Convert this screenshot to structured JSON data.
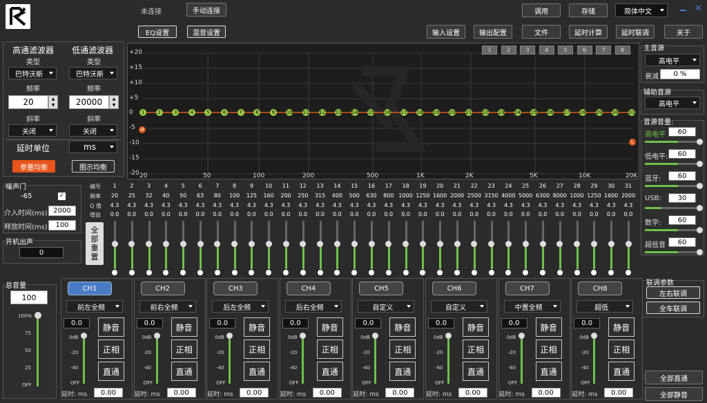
{
  "header": {
    "status": "未连接",
    "connect": "手动连接",
    "tab_eq": "EQ设置",
    "tab_mix": "混音设置",
    "call": "调用",
    "save": "存储",
    "language": "简体中文",
    "nav": [
      "输入设置",
      "输出配置",
      "文件",
      "延时计算",
      "延时联调",
      "关于"
    ]
  },
  "filters": {
    "hp_title": "高通滤波器",
    "lp_title": "低通滤波器",
    "type_label": "类型",
    "hp_type": "巴特沃斯",
    "lp_type": "巴特沃斯",
    "freq_label": "频率",
    "hp_freq": "20",
    "lp_freq": "20000",
    "slope_label": "斜率",
    "hp_slope": "关闭",
    "lp_slope": "关闭",
    "delay_unit_label": "延时单位",
    "delay_unit": "ms",
    "param_eq": "参量均衡",
    "graphic_eq": "图示均衡"
  },
  "noise_gate": {
    "title": "噪声门",
    "value": "-65",
    "attack_label": "介入时间(ms)",
    "attack": "2000",
    "release_label": "释放时间(ms)",
    "release": "100"
  },
  "startup": {
    "title": "开机出声",
    "value": "0"
  },
  "graph": {
    "y_labels": [
      "+20",
      "+15",
      "+10",
      "+5",
      "0",
      "-5",
      "-10",
      "-15",
      "-20"
    ],
    "x_labels": [
      "20",
      "50",
      "100",
      "200",
      "500",
      "1K",
      "2K",
      "5K",
      "10K",
      "20K"
    ],
    "presets": [
      "1",
      "2",
      "3",
      "4",
      "5",
      "6",
      "7",
      "8"
    ],
    "h_marker": "H",
    "l_marker": "L"
  },
  "eq": {
    "row_labels": [
      "编号",
      "频率",
      "Q 值",
      "增益"
    ],
    "freqs": [
      "20",
      "25",
      "32",
      "40",
      "50",
      "63",
      "80",
      "100",
      "125",
      "160",
      "200",
      "250",
      "315",
      "400",
      "500",
      "630",
      "800",
      "1000",
      "1250",
      "1600",
      "2000",
      "2500",
      "3150",
      "4000",
      "5000",
      "6300",
      "8000",
      "1000",
      "1250",
      "1600",
      "2000"
    ],
    "q": "4.3",
    "gain": "0.0",
    "reset": "全部重置"
  },
  "master": {
    "title": "总音量",
    "value": "100",
    "scale": [
      "100%",
      "75",
      "50",
      "25",
      "OFF"
    ]
  },
  "channels": [
    {
      "name": "CH1",
      "pos": "前左全频",
      "val": "0.0",
      "delay": "0.00"
    },
    {
      "name": "CH2",
      "pos": "前右全频",
      "val": "0.0",
      "delay": "0.00"
    },
    {
      "name": "CH3",
      "pos": "后左全频",
      "val": "0.0",
      "delay": "0.00"
    },
    {
      "name": "CH4",
      "pos": "后右全频",
      "val": "0.0",
      "delay": "0.00"
    },
    {
      "name": "CH5",
      "pos": "自定义",
      "val": "0.0",
      "delay": "0.00"
    },
    {
      "name": "CH6",
      "pos": "自定义",
      "val": "0.0",
      "delay": "0.00"
    },
    {
      "name": "CH7",
      "pos": "中置全频",
      "val": "0.0",
      "delay": "0.00"
    },
    {
      "name": "CH8",
      "pos": "超低",
      "val": "0.0",
      "delay": "0.00"
    }
  ],
  "ch_labels": {
    "mute": "静音",
    "phase": "正相",
    "direct": "直通",
    "delay": "延时: ms",
    "scale": [
      "0dB",
      "-20",
      "-40",
      "OFF"
    ]
  },
  "main_source": {
    "title": "主音源",
    "value": "高电平",
    "atten_label": "衰减",
    "atten": "0 %"
  },
  "aux_source": {
    "title": "辅助音源",
    "value": "高电平"
  },
  "source_vol": {
    "title": "音源音量:",
    "items": [
      {
        "label": "高电平",
        "value": "60",
        "level": 0.6
      },
      {
        "label": "低电平:",
        "value": "60",
        "level": 0.6
      },
      {
        "label": "蓝牙:",
        "value": "60",
        "level": 0.6
      },
      {
        "label": "USB:",
        "value": "30",
        "level": 0.3
      },
      {
        "label": "数字:",
        "value": "60",
        "level": 0.6
      },
      {
        "label": "超低音",
        "value": "60",
        "level": 0.6
      }
    ]
  },
  "linkage": {
    "title": "联调参数",
    "lr": "左右联调",
    "all": "全车联调"
  },
  "bottom": {
    "all_direct": "全部直通",
    "all_mute": "全部静音"
  }
}
